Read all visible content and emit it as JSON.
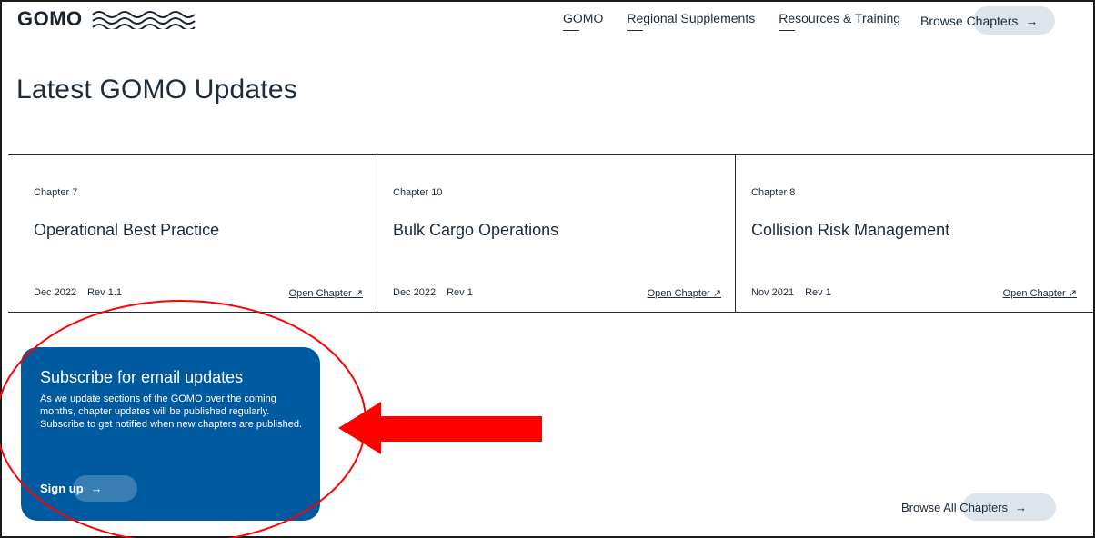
{
  "header": {
    "logo_text": "GOMO",
    "nav": [
      "GOMO",
      "Regional Supplements",
      "Resources & Training"
    ],
    "browse_chapters": "Browse Chapters",
    "arrow": "→"
  },
  "page_title": "Latest GOMO Updates",
  "cards": [
    {
      "chapter": "Chapter 7",
      "title": "Operational Best Practice",
      "date": "Dec 2022",
      "rev": "Rev 1.1",
      "link": "Open Chapter ↗"
    },
    {
      "chapter": "Chapter 10",
      "title": "Bulk Cargo Operations",
      "date": "Dec 2022",
      "rev": "Rev 1",
      "link": "Open Chapter ↗"
    },
    {
      "chapter": "Chapter 8",
      "title": "Collision Risk Management",
      "date": "Nov 2021",
      "rev": "Rev 1",
      "link": "Open Chapter ↗"
    }
  ],
  "subscribe": {
    "heading": "Subscribe for email updates",
    "body": "As we update sections of the GOMO over the coming months, chapter updates will be published regularly. Subscribe to get notified when new chapters are published.",
    "cta": "Sign up",
    "arrow": "→"
  },
  "browse_all": {
    "label": "Browse All Chapters",
    "arrow": "→"
  },
  "colors": {
    "accent_blue": "#005aa0",
    "annotation_red": "#ff0000",
    "pill_bg": "#dde4ec",
    "text": "#1d2b3a"
  }
}
